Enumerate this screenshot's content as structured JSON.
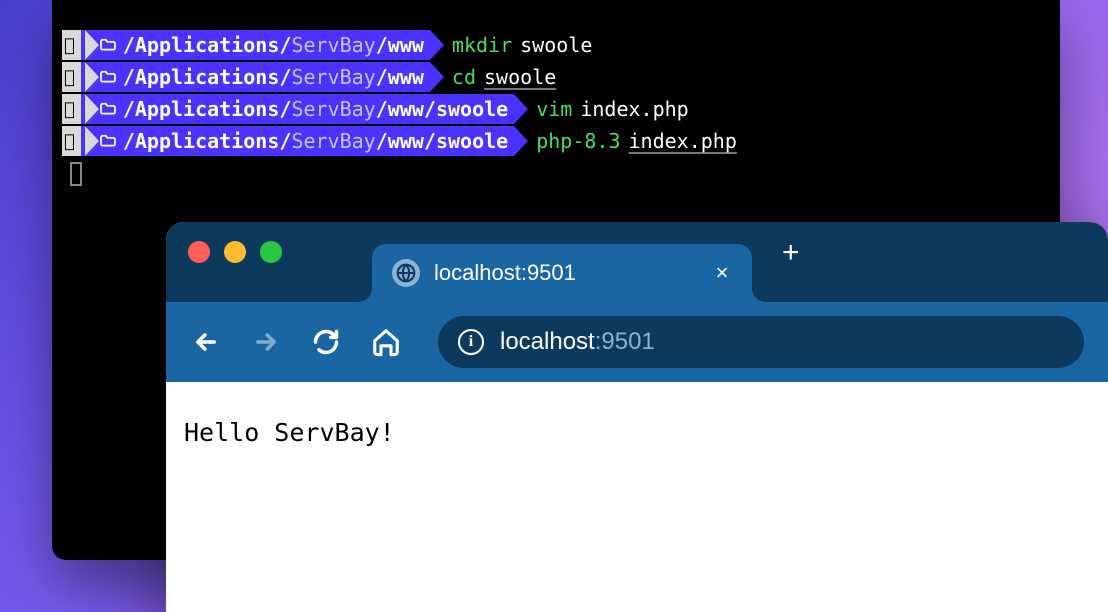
{
  "terminal": {
    "lines": [
      {
        "path_segments": [
          {
            "text": "/",
            "bold": true
          },
          {
            "text": "Applications",
            "bold": true
          },
          {
            "text": "/",
            "bold": true
          },
          {
            "text": "ServBay",
            "bold": false
          },
          {
            "text": "/",
            "bold": true
          },
          {
            "text": "www",
            "bold": true
          }
        ],
        "cmd": "mkdir",
        "arg": "swoole",
        "arg_underline": false
      },
      {
        "path_segments": [
          {
            "text": "/",
            "bold": true
          },
          {
            "text": "Applications",
            "bold": true
          },
          {
            "text": "/",
            "bold": true
          },
          {
            "text": "ServBay",
            "bold": false
          },
          {
            "text": "/",
            "bold": true
          },
          {
            "text": "www",
            "bold": true
          }
        ],
        "cmd": "cd",
        "arg": "swoole",
        "arg_underline": true
      },
      {
        "path_segments": [
          {
            "text": "/",
            "bold": true
          },
          {
            "text": "Applications",
            "bold": true
          },
          {
            "text": "/",
            "bold": true
          },
          {
            "text": "ServBay",
            "bold": false
          },
          {
            "text": "/",
            "bold": true
          },
          {
            "text": "www",
            "bold": true
          },
          {
            "text": "/",
            "bold": true
          },
          {
            "text": "swoole",
            "bold": true
          }
        ],
        "cmd": "vim",
        "arg": "index.php",
        "arg_underline": false
      },
      {
        "path_segments": [
          {
            "text": "/",
            "bold": true
          },
          {
            "text": "Applications",
            "bold": true
          },
          {
            "text": "/",
            "bold": true
          },
          {
            "text": "ServBay",
            "bold": false
          },
          {
            "text": "/",
            "bold": true
          },
          {
            "text": "www",
            "bold": true
          },
          {
            "text": "/",
            "bold": true
          },
          {
            "text": "swoole",
            "bold": true
          }
        ],
        "cmd": "php-8.3",
        "arg": "index.php",
        "arg_underline": true
      }
    ]
  },
  "browser": {
    "tab_title": "localhost:9501",
    "url_host": "localhost",
    "url_port": ":9501",
    "page_text": "Hello ServBay!",
    "newtab_label": "+"
  }
}
